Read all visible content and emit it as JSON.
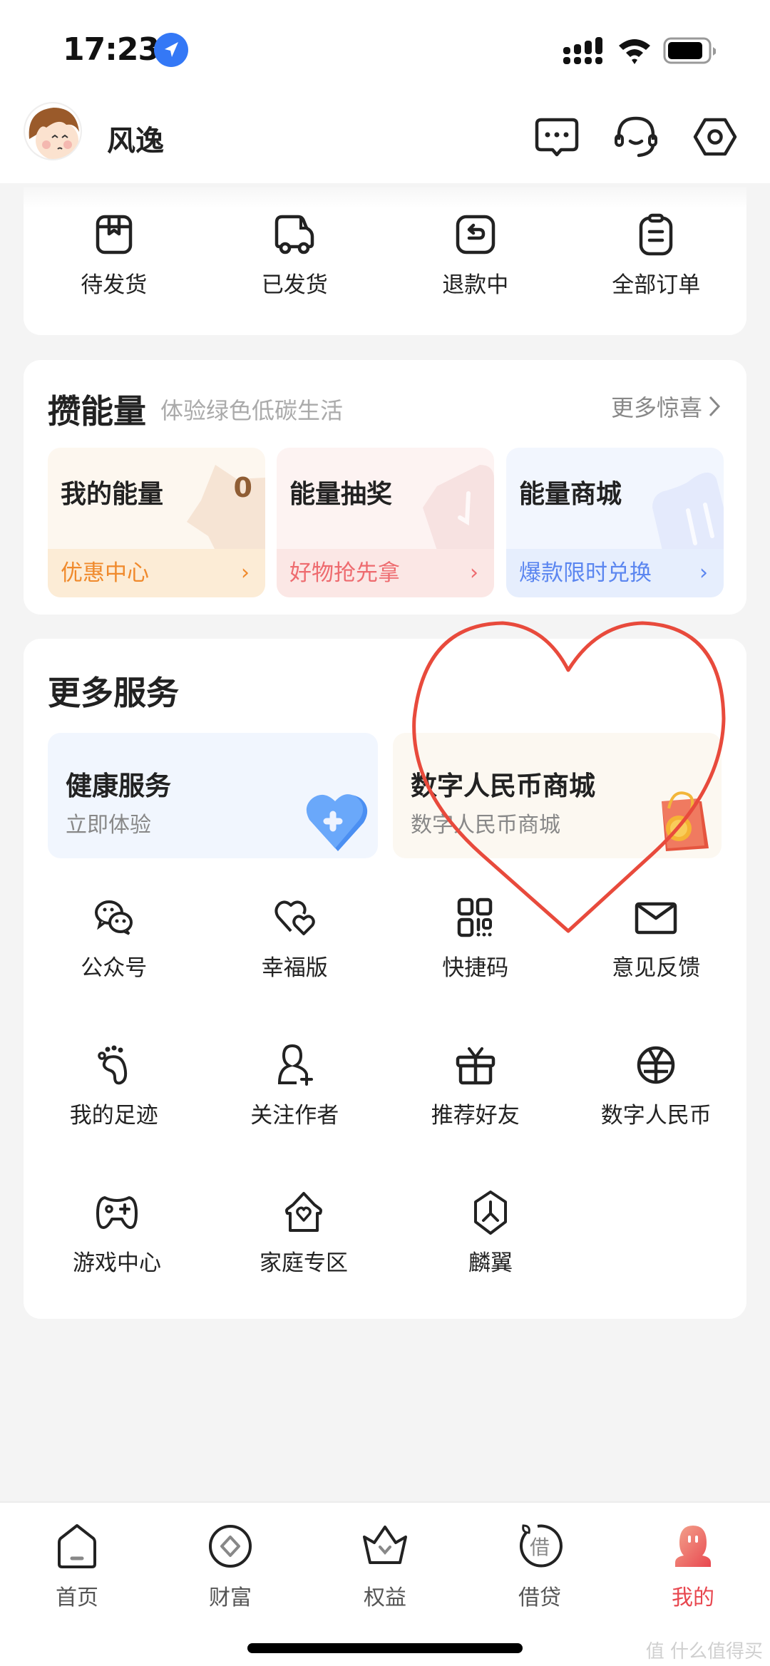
{
  "status_bar": {
    "time": "17:23"
  },
  "header": {
    "username": "风逸"
  },
  "orders": {
    "items": [
      {
        "label": "待发货",
        "icon": "package-icon"
      },
      {
        "label": "已发货",
        "icon": "truck-icon"
      },
      {
        "label": "退款中",
        "icon": "refund-icon"
      },
      {
        "label": "全部订单",
        "icon": "clipboard-icon"
      }
    ]
  },
  "energy": {
    "title": "攒能量",
    "subtitle": "体验绿色低碳生活",
    "more_label": "更多惊喜",
    "cards": [
      {
        "title": "我的能量",
        "value": "0",
        "footer": "优惠中心",
        "accent": "#f08a2c"
      },
      {
        "title": "能量抽奖",
        "footer": "好物抢先拿",
        "accent": "#ee6b6f"
      },
      {
        "title": "能量商城",
        "footer": "爆款限时兑换",
        "accent": "#5b86f0"
      }
    ]
  },
  "services": {
    "title": "更多服务",
    "featured": [
      {
        "title": "健康服务",
        "subtitle": "立即体验"
      },
      {
        "title": "数字人民币商城",
        "subtitle": "数字人民币商城"
      }
    ],
    "grid": [
      {
        "label": "公众号",
        "icon": "wechat-icon"
      },
      {
        "label": "幸福版",
        "icon": "double-heart-icon"
      },
      {
        "label": "快捷码",
        "icon": "qr-code-icon"
      },
      {
        "label": "意见反馈",
        "icon": "mail-icon"
      },
      {
        "label": "我的足迹",
        "icon": "footprint-icon"
      },
      {
        "label": "关注作者",
        "icon": "add-user-icon"
      },
      {
        "label": "推荐好友",
        "icon": "gift-icon"
      },
      {
        "label": "数字人民币",
        "icon": "yuan-coin-icon"
      },
      {
        "label": "游戏中心",
        "icon": "gamepad-icon"
      },
      {
        "label": "家庭专区",
        "icon": "home-heart-icon"
      },
      {
        "label": "麟翼",
        "icon": "hexagon-logo-icon"
      }
    ]
  },
  "bottom_nav": {
    "items": [
      {
        "label": "首页",
        "icon": "home-icon",
        "active": false
      },
      {
        "label": "财富",
        "icon": "wealth-icon",
        "active": false
      },
      {
        "label": "权益",
        "icon": "crown-icon",
        "active": false
      },
      {
        "label": "借贷",
        "icon": "loan-icon",
        "active": false
      },
      {
        "label": "我的",
        "icon": "profile-icon",
        "active": true
      }
    ],
    "active_color": "#e8474f"
  },
  "annotation": {
    "shape": "heart",
    "color": "#e84a3c"
  },
  "watermark": "值 什么值得买"
}
